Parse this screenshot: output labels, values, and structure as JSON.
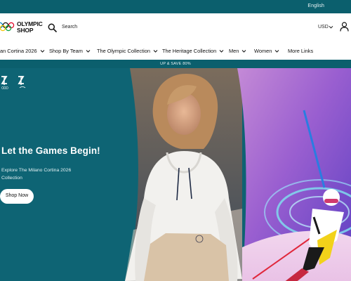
{
  "topbar": {
    "language": "English"
  },
  "header": {
    "logo_line1": "OLYMPIC",
    "logo_line2": "SHOP",
    "search_label": "Search",
    "currency": "USD"
  },
  "nav": {
    "items": [
      {
        "label": "an Cortina 2026"
      },
      {
        "label": "Shop By Team"
      },
      {
        "label": "The Olympic Collection"
      },
      {
        "label": "The Heritage Collection"
      },
      {
        "label": "Men"
      },
      {
        "label": "Women"
      },
      {
        "label": "More Links"
      }
    ]
  },
  "promo": {
    "text": "UP & SAVE 80%"
  },
  "hero": {
    "title": "Let the Games Begin!",
    "subtitle": "Explore The Milano Cortina 2026 Collection",
    "button_label": "Shop Now"
  },
  "colors": {
    "brand_teal": "#0b5f6d",
    "hero_teal": "#0e6474",
    "white": "#ffffff"
  },
  "icons": [
    "olympic-rings-icon",
    "search-icon",
    "chevron-down-icon",
    "account-icon",
    "milano-cortina-logo-icon"
  ]
}
